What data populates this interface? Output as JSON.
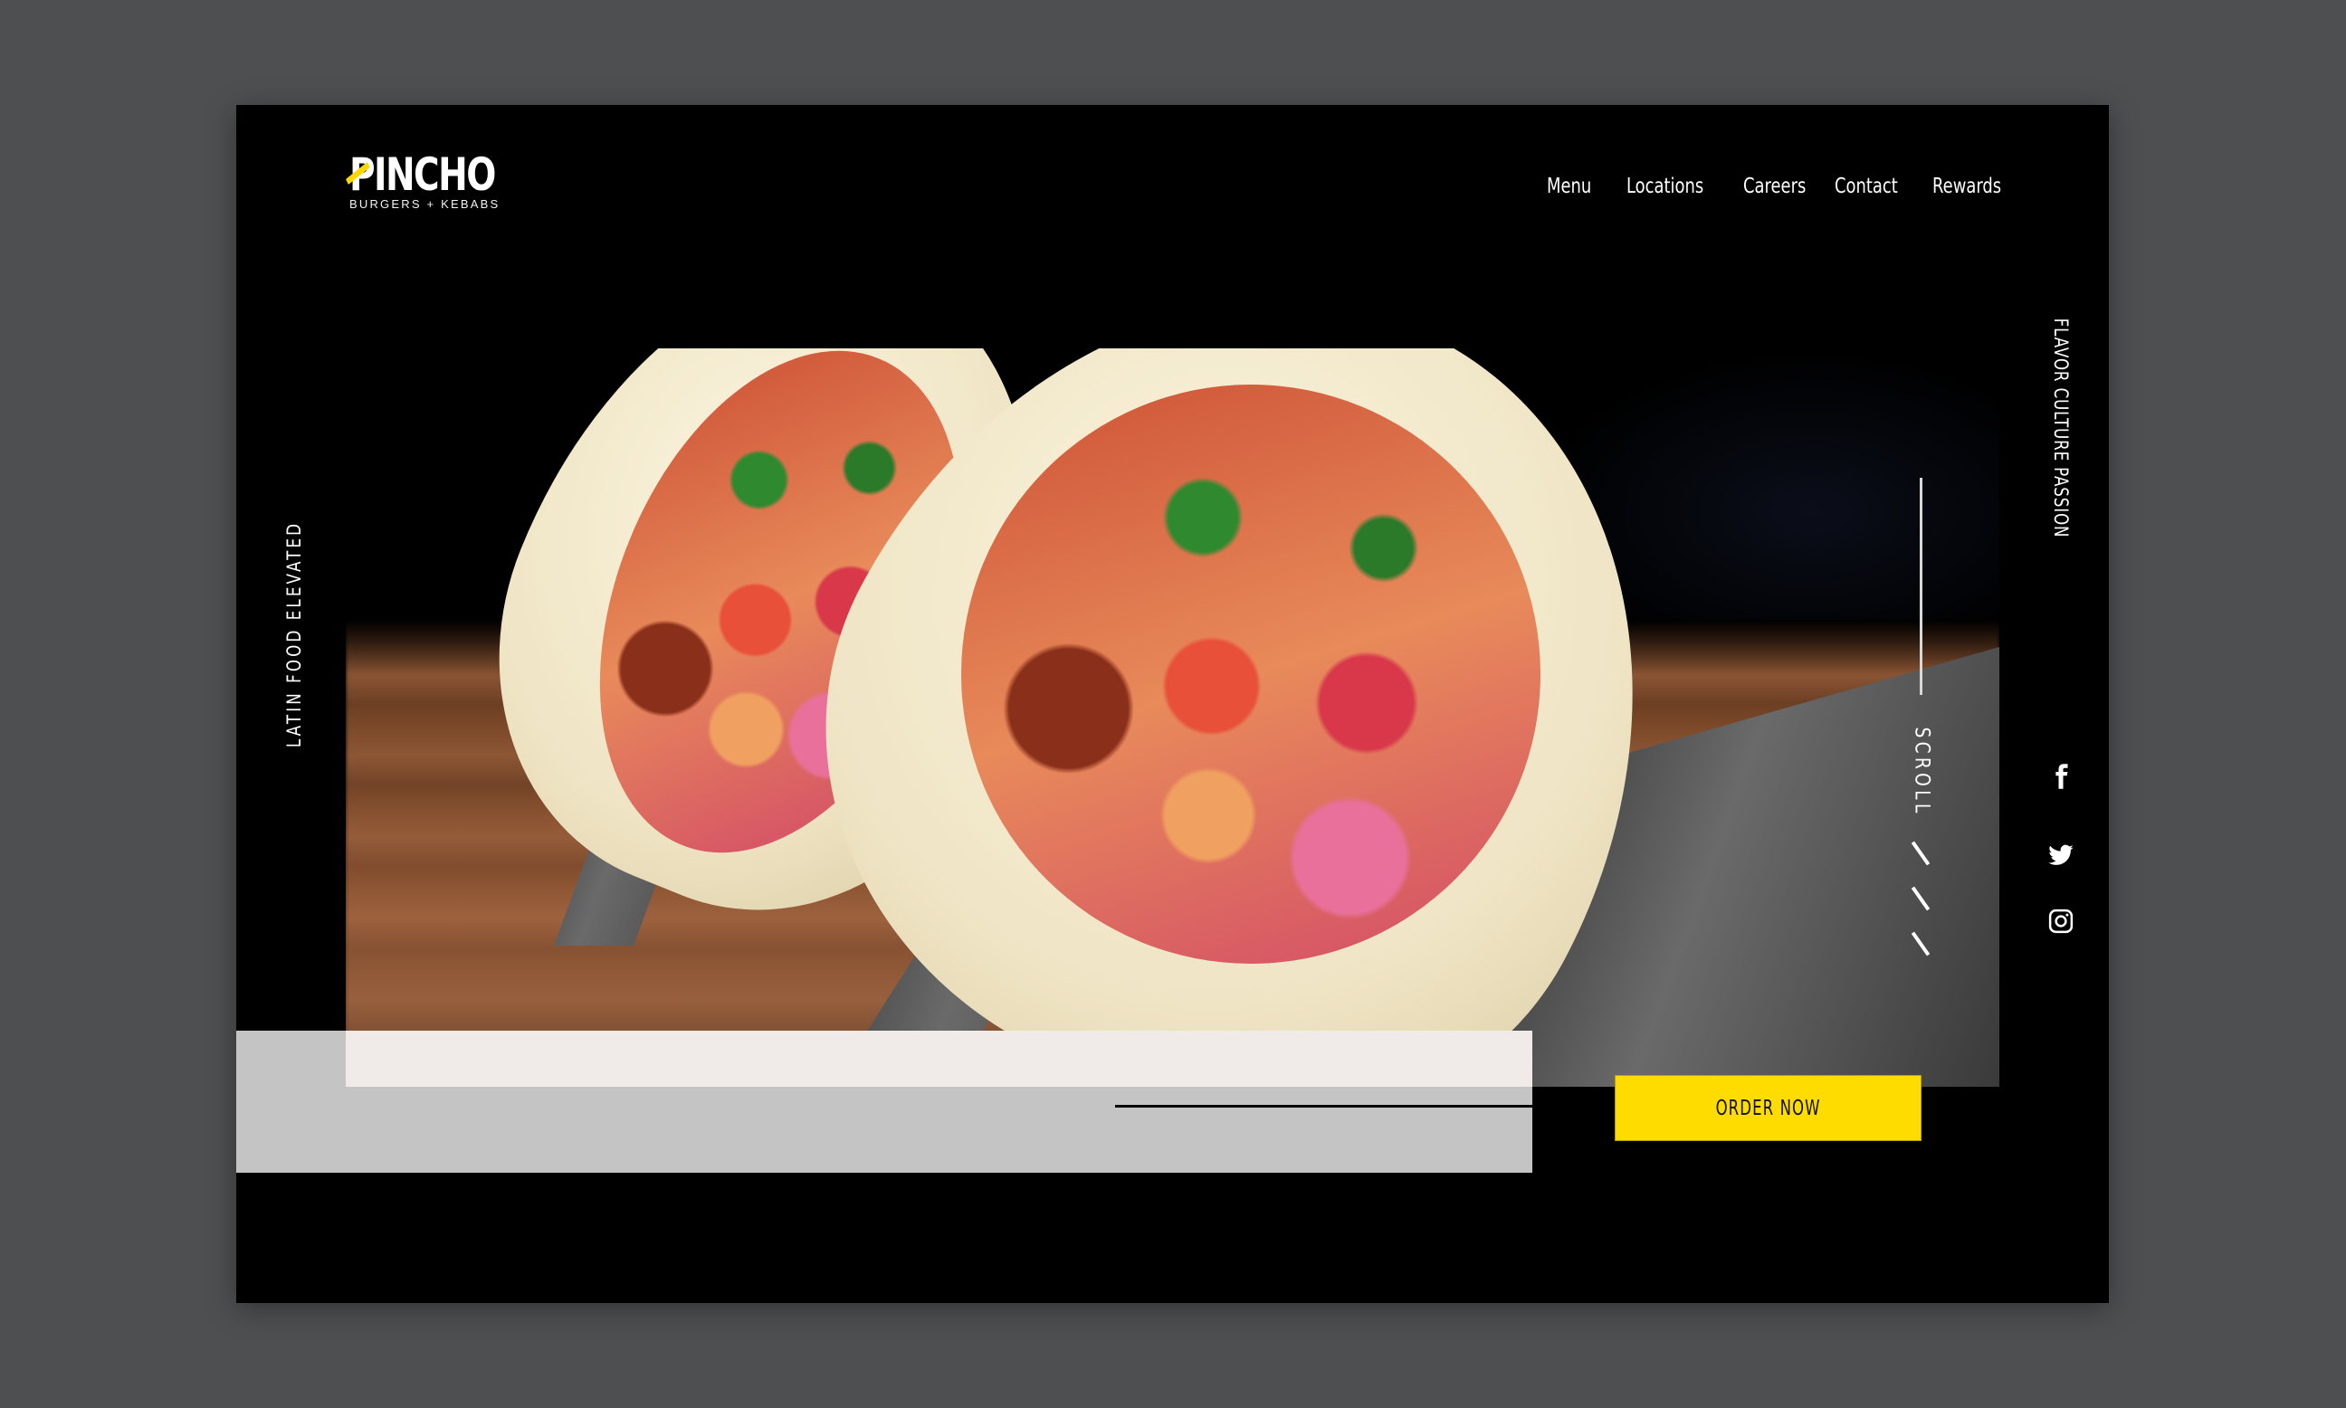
{
  "brand": {
    "name": "PINCHO",
    "tagline": "BURGERS + KEBABS",
    "accent_color": "#FFDC00"
  },
  "nav": {
    "items": [
      {
        "label": "Menu"
      },
      {
        "label": "Locations"
      },
      {
        "label": "Careers"
      },
      {
        "label": "Contact"
      },
      {
        "label": "Rewards"
      }
    ]
  },
  "hero": {
    "left_vertical_text": "LATIN FOOD ELEVATED",
    "right_vertical_text": "FLAVOR CULTURE PASSION",
    "scroll_label": "SCROLL",
    "image_alt": "Two tacos with meat, pico de gallo, pickled onions, cilantro and chipotle sauce on a metal taco stand",
    "cta_label": "ORDER NOW"
  },
  "social": {
    "items": [
      {
        "icon": "facebook-icon"
      },
      {
        "icon": "twitter-icon"
      },
      {
        "icon": "instagram-icon"
      }
    ]
  },
  "colors": {
    "page_background": "#4E4F51",
    "frame_background": "#000000",
    "panel_gray": "#C4C4C4",
    "cta_yellow": "#FFDC00"
  }
}
